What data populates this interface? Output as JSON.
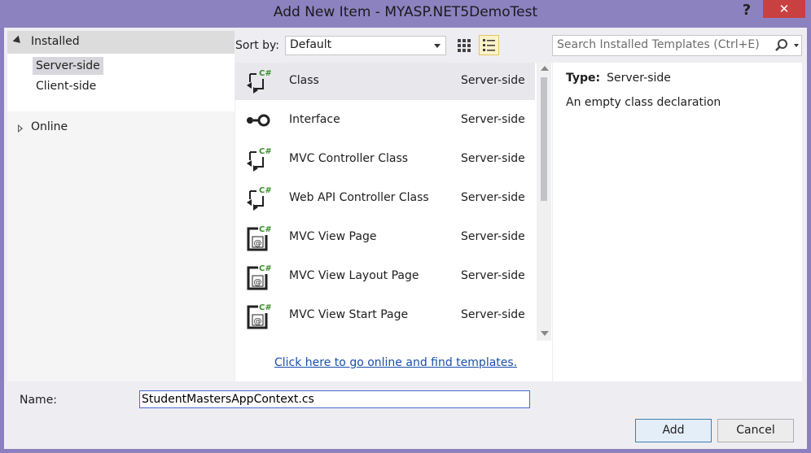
{
  "window": {
    "title": "Add New Item - MYASP.NET5DemoTest",
    "help_symbol": "?",
    "close_symbol": "✕"
  },
  "tree": {
    "installed": "Installed",
    "children": [
      "Server-side",
      "Client-side"
    ],
    "selected": "Server-side",
    "online": "Online"
  },
  "toolbar": {
    "sort_label": "Sort by:",
    "sort_value": "Default",
    "search_placeholder": "Search Installed Templates (Ctrl+E)"
  },
  "templates": [
    {
      "name": "Class",
      "category": "Server-side",
      "icon": "csharp-class-icon",
      "selected": true
    },
    {
      "name": "Interface",
      "category": "Server-side",
      "icon": "interface-icon"
    },
    {
      "name": "MVC Controller Class",
      "category": "Server-side",
      "icon": "csharp-class-icon"
    },
    {
      "name": "Web API Controller Class",
      "category": "Server-side",
      "icon": "csharp-class-icon"
    },
    {
      "name": "MVC View Page",
      "category": "Server-side",
      "icon": "razor-page-icon"
    },
    {
      "name": "MVC View Layout Page",
      "category": "Server-side",
      "icon": "razor-page-icon"
    },
    {
      "name": "MVC View Start Page",
      "category": "Server-side",
      "icon": "razor-page-icon"
    }
  ],
  "online_link": "Click here to go online and find templates.",
  "details": {
    "type_label": "Type:",
    "type_value": "Server-side",
    "description": "An empty class declaration"
  },
  "form": {
    "name_label": "Name:",
    "name_value": "StudentMastersAppContext.cs",
    "add_label": "Add",
    "cancel_label": "Cancel"
  },
  "colors": {
    "titlebar": "#8d82c0",
    "close": "#c94040",
    "link": "#1a4fa8",
    "csharp_green": "#3a8f2a"
  }
}
